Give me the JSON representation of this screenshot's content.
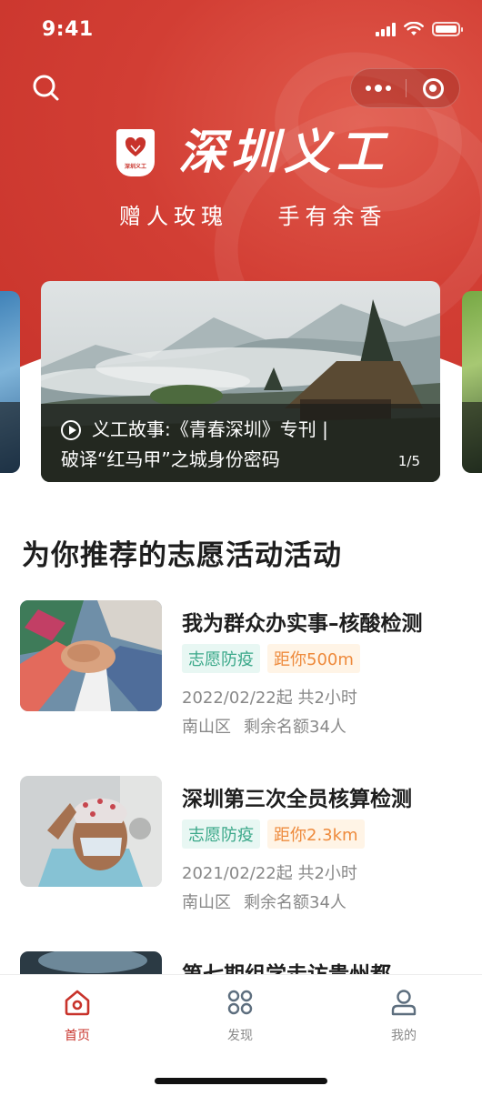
{
  "status_bar": {
    "time": "9:41"
  },
  "header": {
    "brand_name": "深圳义工",
    "slogan": "赠人玫瑰    手有余香",
    "accent_color": "#c8332b",
    "icons": [
      "search-icon",
      "more-icon",
      "close-target-icon"
    ]
  },
  "banner": {
    "line1": "义工故事:《青春深圳》专刊 |",
    "line2": "破译“红马甲”之城身份密码",
    "pager": "1/5"
  },
  "recommend": {
    "section_title": "为你推荐的志愿活动活动",
    "items": [
      {
        "title": "我为群众办实事–核酸检测",
        "tag1": "志愿防疫",
        "tag2": "距你500m",
        "date": "2022/02/22起 共2小时",
        "district": "南山区",
        "quota": "剩余名额34人"
      },
      {
        "title": "深圳第三次全员核算检测",
        "tag1": "志愿防疫",
        "tag2": "距你2.3km",
        "date": "2021/02/22起 共2小时",
        "district": "南山区",
        "quota": "剩余名额34人"
      },
      {
        "title": "第七期组学走访贵州都"
      }
    ]
  },
  "tabbar": {
    "items": [
      {
        "label": "首页",
        "icon": "home-icon",
        "active": true
      },
      {
        "label": "发现",
        "icon": "discover-icon",
        "active": false
      },
      {
        "label": "我的",
        "icon": "profile-icon",
        "active": false
      }
    ]
  }
}
